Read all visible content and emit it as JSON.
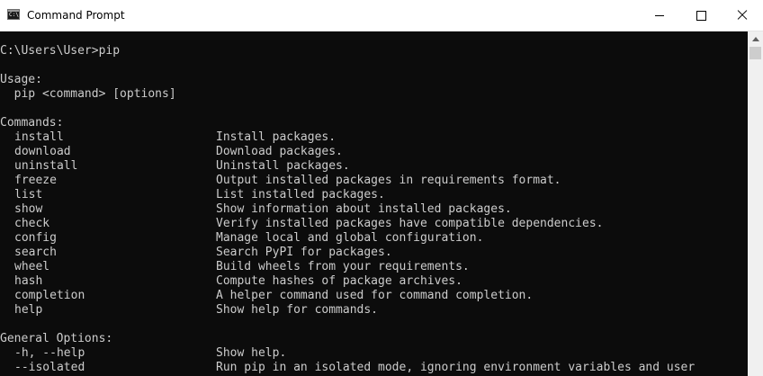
{
  "window": {
    "title": "Command Prompt",
    "app_icon_glyph": "C:\\."
  },
  "console": {
    "prompt_line": "C:\\Users\\User>pip",
    "usage_header": "Usage:",
    "usage_line": "  pip <command> [options]",
    "commands_header": "Commands:",
    "commands": [
      {
        "name": "install",
        "desc": "Install packages."
      },
      {
        "name": "download",
        "desc": "Download packages."
      },
      {
        "name": "uninstall",
        "desc": "Uninstall packages."
      },
      {
        "name": "freeze",
        "desc": "Output installed packages in requirements format."
      },
      {
        "name": "list",
        "desc": "List installed packages."
      },
      {
        "name": "show",
        "desc": "Show information about installed packages."
      },
      {
        "name": "check",
        "desc": "Verify installed packages have compatible dependencies."
      },
      {
        "name": "config",
        "desc": "Manage local and global configuration."
      },
      {
        "name": "search",
        "desc": "Search PyPI for packages."
      },
      {
        "name": "wheel",
        "desc": "Build wheels from your requirements."
      },
      {
        "name": "hash",
        "desc": "Compute hashes of package archives."
      },
      {
        "name": "completion",
        "desc": "A helper command used for command completion."
      },
      {
        "name": "help",
        "desc": "Show help for commands."
      }
    ],
    "general_header": "General Options:",
    "options": [
      {
        "name": "-h, --help",
        "desc": "Show help."
      },
      {
        "name": "--isolated",
        "desc": "Run pip in an isolated mode, ignoring environment variables and user"
      }
    ]
  },
  "colors": {
    "console_bg": "#0c0c0c",
    "console_fg": "#cccccc",
    "titlebar_bg": "#ffffff"
  }
}
